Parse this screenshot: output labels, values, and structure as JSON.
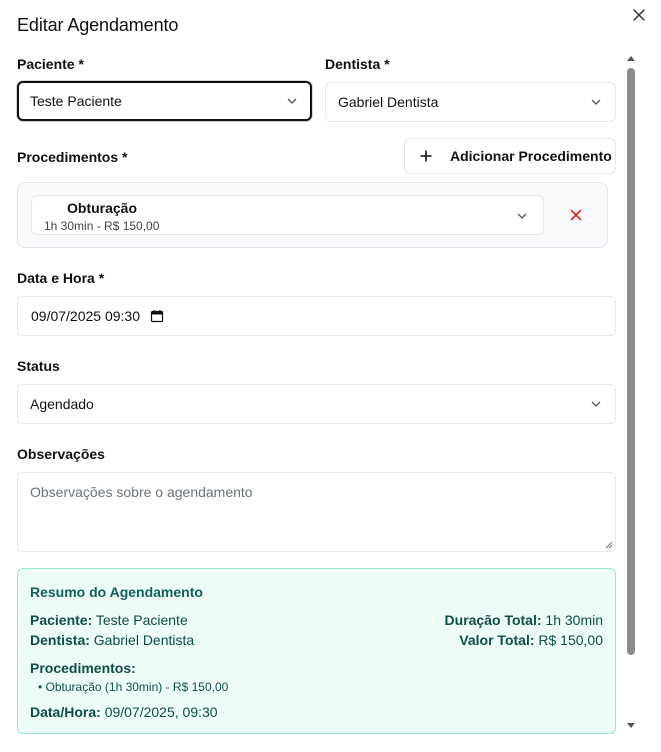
{
  "dialog": {
    "title": "Editar Agendamento"
  },
  "paciente": {
    "label": "Paciente *",
    "value": "Teste Paciente"
  },
  "dentista": {
    "label": "Dentista *",
    "value": "Gabriel Dentista"
  },
  "procedimentos": {
    "label": "Procedimentos *",
    "add_label": "Adicionar Procedimento",
    "items": [
      {
        "name": "Obturação",
        "detail": "1h 30min - R$ 150,00"
      }
    ]
  },
  "data_hora": {
    "label": "Data e Hora *",
    "value": "09/07/2025 09:30"
  },
  "status": {
    "label": "Status",
    "value": "Agendado"
  },
  "observacoes": {
    "label": "Observações",
    "placeholder": "Observações sobre o agendamento"
  },
  "resumo": {
    "title": "Resumo do Agendamento",
    "paciente_label": "Paciente:",
    "paciente_value": "Teste Paciente",
    "dentista_label": "Dentista:",
    "dentista_value": "Gabriel Dentista",
    "duracao_label": "Duração Total:",
    "duracao_value": "1h 30min",
    "valor_label": "Valor Total:",
    "valor_value": "R$ 150,00",
    "procedimentos_label": "Procedimentos:",
    "procedimentos_items": [
      "• Obturação (1h 30min) - R$ 150,00"
    ],
    "datahora_label": "Data/Hora:",
    "datahora_value": "09/07/2025, 09:30"
  },
  "icons": {
    "close": "close-icon",
    "chevron": "chevron-down-icon",
    "plus": "plus-icon",
    "remove": "x-icon",
    "calendar": "calendar-icon"
  },
  "colors": {
    "remove": "#dc2626",
    "summary_bg": "#ecfdf8",
    "summary_border": "#99e6d1",
    "summary_text": "#0f4c48"
  }
}
